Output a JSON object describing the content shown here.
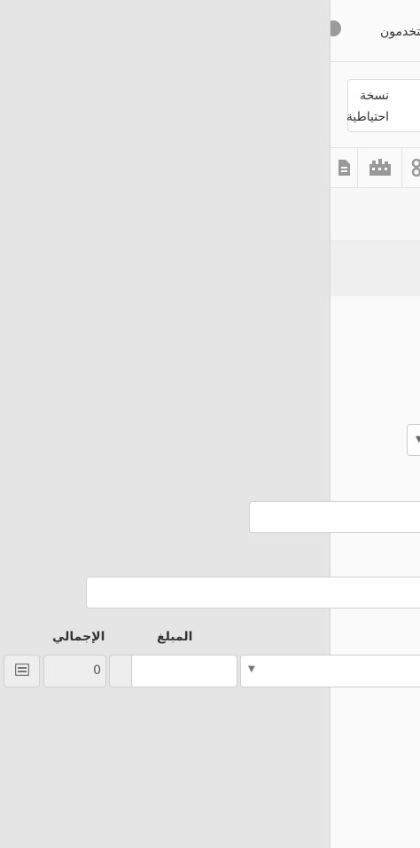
{
  "header": {
    "users_label": "مستخدمون"
  },
  "backup": {
    "line1": "نسخة",
    "line2": "احتياطية"
  },
  "toolbar": {
    "icons": [
      "file-icon",
      "building-icon",
      "group-icon"
    ]
  },
  "form": {
    "amount_label": "المبلغ",
    "total_label": "الإجمالي",
    "amount_value": "",
    "total_value": "0",
    "select_caret": "▼",
    "dropdown_caret": "▼"
  }
}
